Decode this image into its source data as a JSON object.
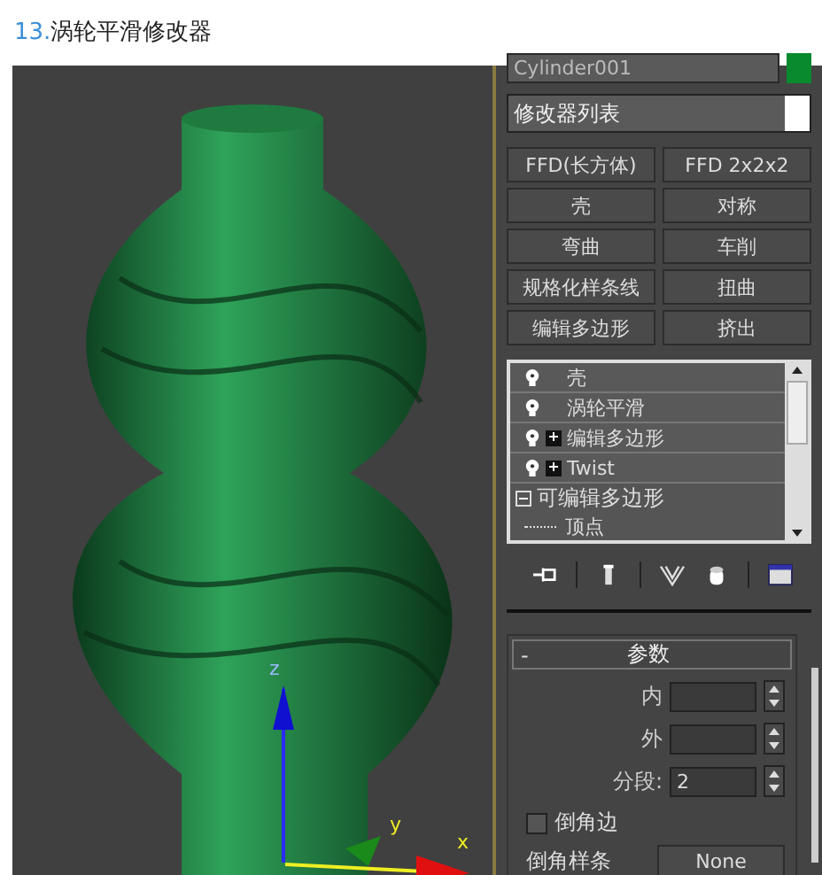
{
  "title": {
    "number": "13.",
    "text": "涡轮平滑修改器"
  },
  "viewport": {
    "axis_labels": [
      "z",
      "y",
      "x"
    ]
  },
  "panel": {
    "object_name": "Cylinder001",
    "modifier_list": "修改器列表",
    "buttons": [
      "FFD(长方体)",
      "FFD 2x2x2",
      "壳",
      "对称",
      "弯曲",
      "车削",
      "规格化样条线",
      "扭曲",
      "编辑多边形",
      "挤出"
    ],
    "stack": [
      {
        "label": "壳",
        "kind": "modifier"
      },
      {
        "label": "涡轮平滑",
        "kind": "modifier"
      },
      {
        "label": "编辑多边形",
        "kind": "modifier",
        "expanded": false
      },
      {
        "label": "Twist",
        "kind": "modifier",
        "expanded": false
      },
      {
        "label": "可编辑多边形",
        "kind": "object",
        "expanded": true,
        "children": [
          {
            "label": "顶点"
          }
        ]
      }
    ],
    "rollout": {
      "title": "参数",
      "collapse_sign": "-",
      "fields": [
        {
          "label": "内"
        },
        {
          "label": "外"
        },
        {
          "label": "分段:",
          "value": "2"
        }
      ],
      "bevel_edge": {
        "label": "倒角边",
        "checked": false
      },
      "bevel_spline": {
        "label": "倒角样条",
        "button": "None"
      }
    }
  }
}
